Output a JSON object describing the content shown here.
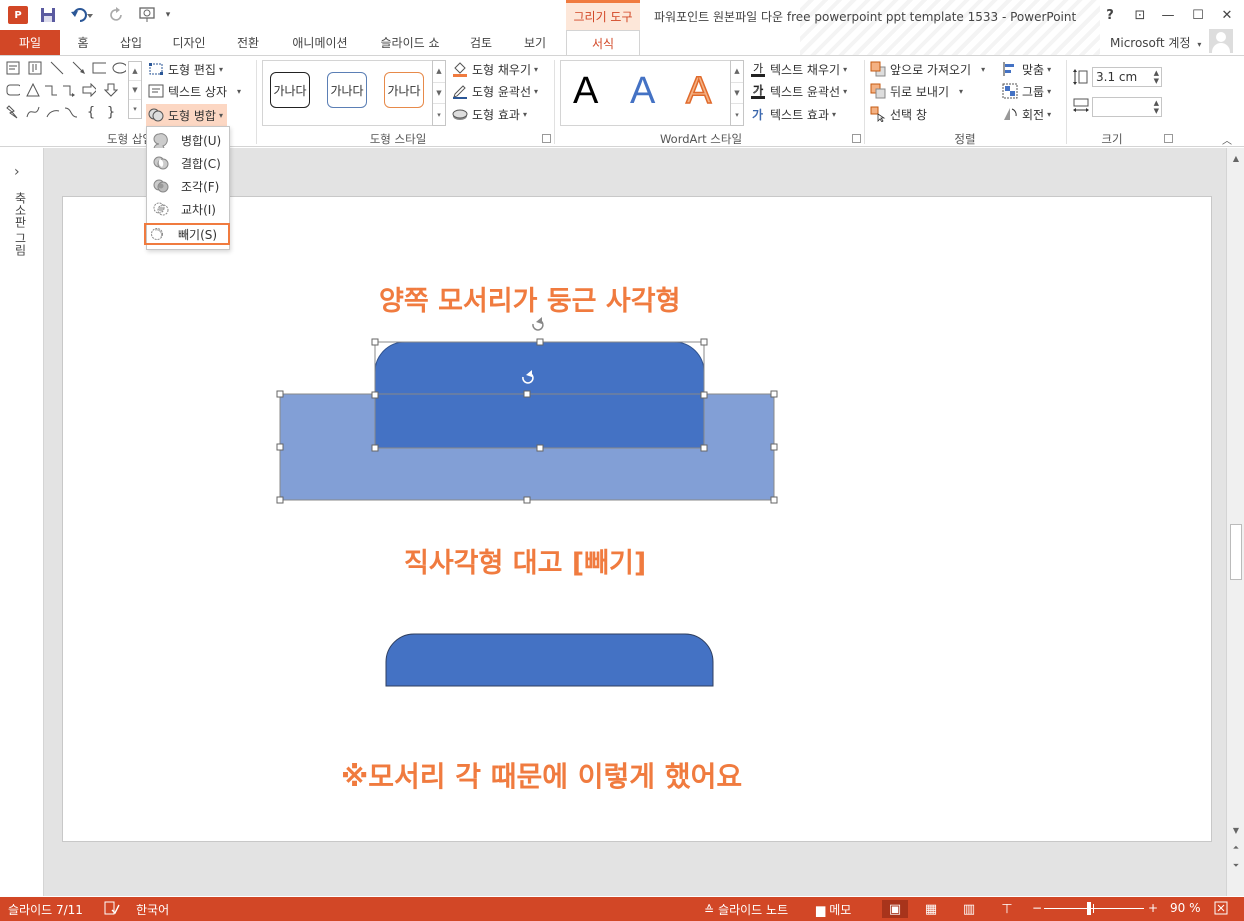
{
  "window": {
    "title": "파워포인트 원본파일 다운 free powerpoint ppt template 1533 - PowerPoint",
    "context_tool": "그리기 도구",
    "app_badge": "P",
    "help": "?",
    "ribbon_display": "⊡",
    "minimize": "—",
    "maximize": "☐",
    "close": "✕"
  },
  "tabs": [
    {
      "label": "파일"
    },
    {
      "label": "홈"
    },
    {
      "label": "삽입"
    },
    {
      "label": "디자인"
    },
    {
      "label": "전환"
    },
    {
      "label": "애니메이션"
    },
    {
      "label": "슬라이드 쇼"
    },
    {
      "label": "검토"
    },
    {
      "label": "보기"
    },
    {
      "label": "서식"
    }
  ],
  "account": "Microsoft 계정",
  "ribbon": {
    "insert_shapes": {
      "label": "도형 삽입",
      "edit_shape": "도형 편집",
      "text_box": "텍스트 상자",
      "merge_shapes": "도형 병합"
    },
    "shape_styles": {
      "label": "도형 스타일",
      "swatch_text": "가나다",
      "fill": "도형 채우기",
      "outline": "도형 윤곽선",
      "effects": "도형 효과"
    },
    "wordart": {
      "label": "WordArt 스타일",
      "letter": "A",
      "text_fill": "텍스트 채우기",
      "text_outline": "텍스트 윤곽선",
      "text_effects": "텍스트 효과"
    },
    "arrange": {
      "label": "정렬",
      "bring_forward": "앞으로 가져오기",
      "send_backward": "뒤로 보내기",
      "selection_pane": "선택 창",
      "align": "맞춤",
      "group": "그룹",
      "rotate": "회전"
    },
    "size": {
      "label": "크기",
      "height": "3.1 cm",
      "width": ""
    }
  },
  "merge_menu": [
    {
      "label": "병합(U)",
      "icon": "union-icon"
    },
    {
      "label": "결합(C)",
      "icon": "combine-icon"
    },
    {
      "label": "조각(F)",
      "icon": "fragment-icon"
    },
    {
      "label": "교차(I)",
      "icon": "intersect-icon"
    },
    {
      "label": "빼기(S)",
      "icon": "subtract-icon",
      "highlighted": true
    }
  ],
  "thumbnails_pane": {
    "label": "축소판 그림",
    "expand": "›"
  },
  "slide": {
    "heading1": "양쪽 모서리가 둥근 사각형",
    "heading2": "직사각형 대고 [빼기]",
    "note": "※모서리 각 때문에 이렇게 했어요"
  },
  "colors": {
    "accent": "#D24726",
    "slide_text": "#F07B3F",
    "shape_dark": "#4472C4",
    "shape_light": "#829FD6"
  },
  "statusbar": {
    "slide_indicator": "슬라이드 7/11",
    "language": "한국어",
    "notes": "슬라이드 노트",
    "comments": "메모",
    "zoom": "90 %",
    "zoom_level": 0.45
  }
}
